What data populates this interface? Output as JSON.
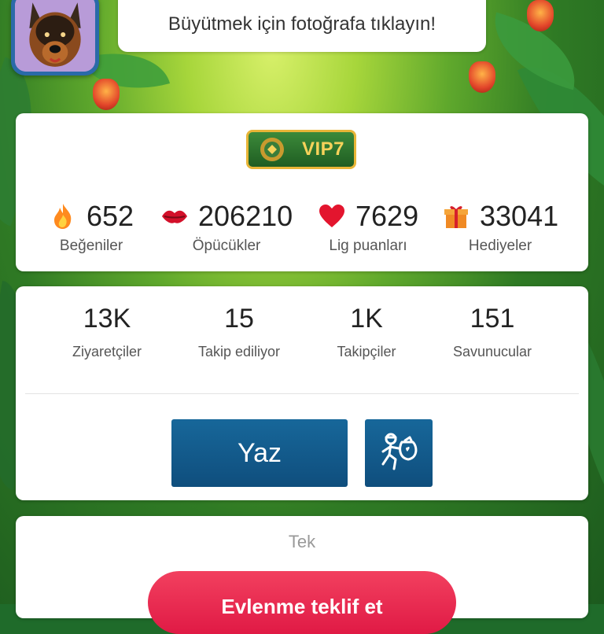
{
  "banner": {
    "text": "Büyütmek için fotoğrafa tıklayın!"
  },
  "vip": {
    "label": "VIP7"
  },
  "stats": [
    {
      "icon": "fire-icon",
      "value": "652",
      "label": "Beğeniler"
    },
    {
      "icon": "kiss-icon",
      "value": "206210",
      "label": "Öpücükler"
    },
    {
      "icon": "heart-icon",
      "value": "7629",
      "label": "Lig puanları"
    },
    {
      "icon": "gift-icon",
      "value": "33041",
      "label": "Hediyeler"
    }
  ],
  "social": [
    {
      "value": "13K",
      "label": "Ziyaretçiler"
    },
    {
      "value": "15",
      "label": "Takip ediliyor"
    },
    {
      "value": "1K",
      "label": "Takipçiler"
    },
    {
      "value": "151",
      "label": "Savunucular"
    }
  ],
  "actions": {
    "write_label": "Yaz",
    "gift_icon": "thief-with-heart-bag-icon"
  },
  "relationship": {
    "status": "Tek",
    "propose_label": "Evlenme teklif et"
  },
  "colors": {
    "accent_blue": "#0f4e7d",
    "propose_red": "#e01a45",
    "vip_gold": "#e8b537"
  }
}
